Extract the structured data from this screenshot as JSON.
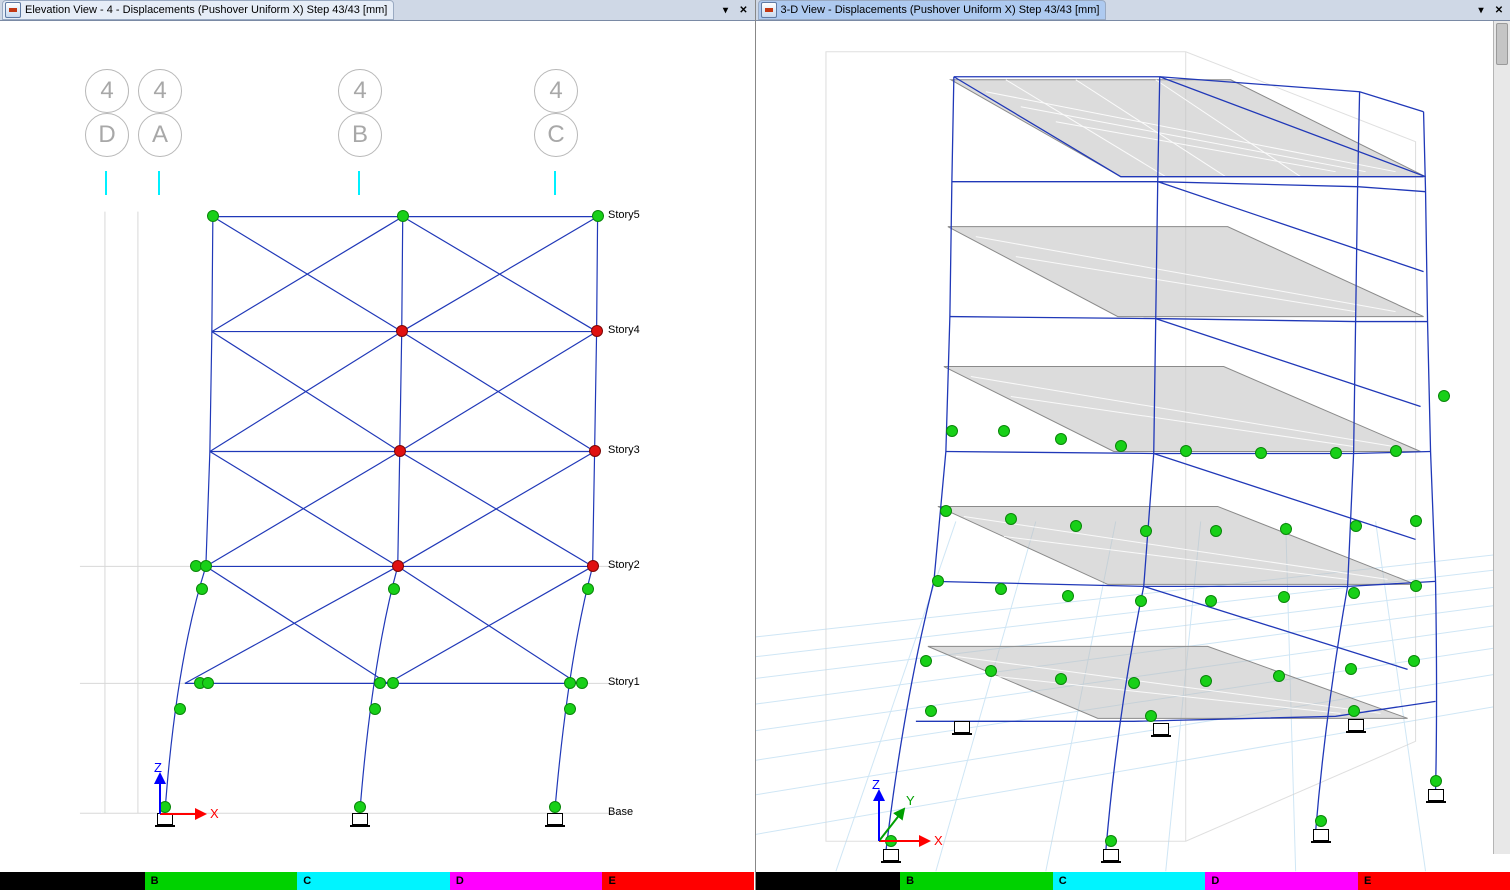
{
  "left_pane": {
    "tab_title": "Elevation View - 4   - Displacements (Pushover Uniform X)  Step 43/43  [mm]",
    "grid_row_labels": [
      "4",
      "4",
      "4",
      "4"
    ],
    "grid_col_labels": [
      "D",
      "A",
      "B",
      "C"
    ],
    "story_labels": [
      "Story5",
      "Story4",
      "Story3",
      "Story2",
      "Story1",
      "Base"
    ],
    "axis_x_label": "X",
    "axis_z_label": "Z"
  },
  "right_pane": {
    "tab_title": "3-D View   - Displacements (Pushover Uniform X)  Step 43/43  [mm]",
    "axis_x_label": "X",
    "axis_y_label": "Y",
    "axis_z_label": "Z"
  },
  "legend": {
    "items": [
      {
        "label": "",
        "color": "#000000"
      },
      {
        "label": "B",
        "color": "#00d200"
      },
      {
        "label": "C",
        "color": "#00f4ff"
      },
      {
        "label": "D",
        "color": "#ff00ff"
      },
      {
        "label": "E",
        "color": "#ff0000"
      }
    ]
  }
}
